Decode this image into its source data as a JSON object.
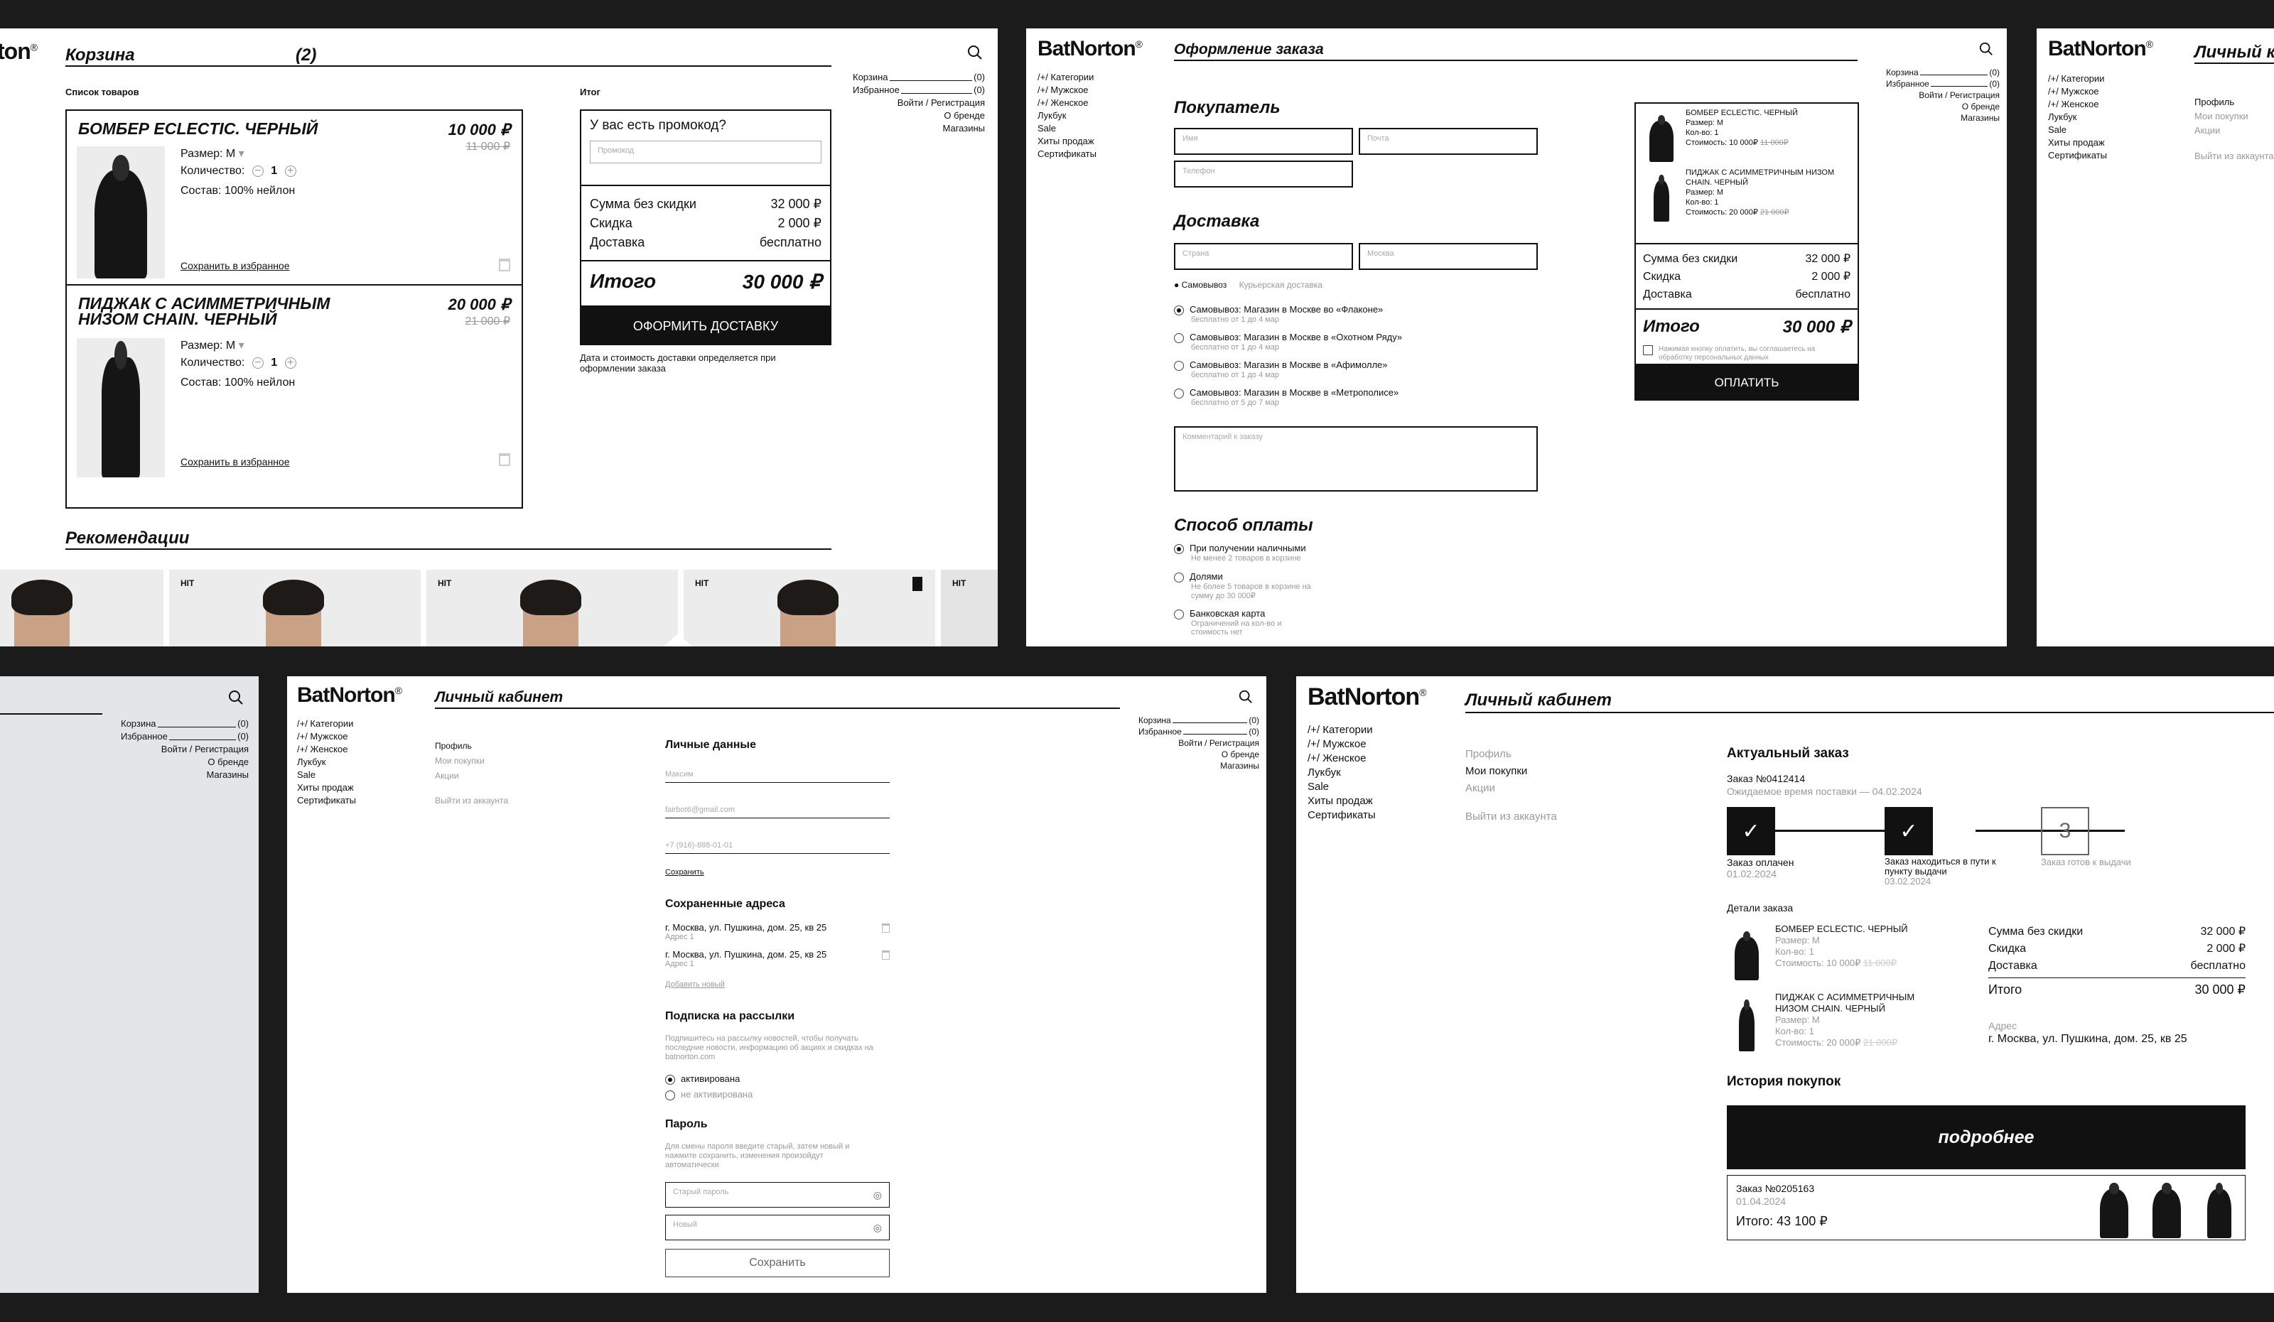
{
  "brand": "BatNorton",
  "reg": "®",
  "topnav": [
    {
      "label": "Корзина",
      "count": "(0)"
    },
    {
      "label": "Избранное",
      "count": "(0)"
    },
    {
      "label": "Войти / Регистрация",
      "count": ""
    },
    {
      "label": "О бренде",
      "count": ""
    },
    {
      "label": "Магазины",
      "count": ""
    }
  ],
  "sidenav": [
    "/+/ Категории",
    "/+/ Мужское",
    "/+/ Женское",
    "Лукбук",
    "Sale",
    "Хиты продаж",
    "Сертификаты"
  ],
  "cart": {
    "title": "Корзина",
    "count": "(2)",
    "brand_fragment": "ton",
    "list_label": "Список товаров",
    "total_label": "Итог",
    "items": [
      {
        "name": "БОМБЕР ECLECTIC. ЧЕРНЫЙ",
        "price": "10 000 ₽",
        "old_price": "11 000 ₽",
        "size_label": "Размер:",
        "size": "M",
        "qty_label": "Количество:",
        "qty": "1",
        "composition": "Состав: 100% нейлон",
        "save": "Сохранить в избранное"
      },
      {
        "name": "ПИДЖАК С АСИММЕТРИЧНЫМ НИЗОМ CHAIN. ЧЕРНЫЙ",
        "price": "20 000 ₽",
        "old_price": "21 000 ₽",
        "size_label": "Размер:",
        "size": "M",
        "qty_label": "Количество:",
        "qty": "1",
        "composition": "Состав: 100% нейлон",
        "save": "Сохранить в избранное"
      }
    ],
    "promo_q": "У вас есть промокод?",
    "promo_ph": "Промокод",
    "sum_label": "Сумма без скидки",
    "sum": "32 000 ₽",
    "disc_label": "Скидка",
    "disc": "2 000 ₽",
    "deliv_label": "Доставка",
    "deliv": "бесплатно",
    "total_big_label": "Итого",
    "total_big": "30 000 ₽",
    "checkout": "ОФОРМИТЬ ДОСТАВКУ",
    "note": "Дата и стоимость доставки определяется при оформлении заказа",
    "reco_title": "Рекомендации",
    "hit": "HIT"
  },
  "checkout": {
    "title": "Оформление заказа",
    "buyer": "Покупатель",
    "name_ph": "Имя",
    "mail_ph": "Почта",
    "phone_ph": "Телефон",
    "delivery": "Доставка",
    "country_ph": "Страна",
    "city_ph": "Москва",
    "tab_pickup": "Самовывоз",
    "tab_courier": "Курьерская доставка",
    "pickups": [
      {
        "title": "Самовывоз: Магазин в Москве во «Флаконе»",
        "sub": "бесплатно от 1 до 4 мар"
      },
      {
        "title": "Самовывоз: Магазин в Москве в «Охотном Ряду»",
        "sub": "бесплатно от 1 до 4 мар"
      },
      {
        "title": "Самовывоз: Магазин в Москве в «Афимолле»",
        "sub": "бесплатно от 1 до 4 мар"
      },
      {
        "title": "Самовывоз: Магазин в Москве в «Метрополисе»",
        "sub": "бесплатно от 5 до 7 мар"
      }
    ],
    "comment_ph": "Комментарий к заказу",
    "pay_title": "Способ оплаты",
    "pays": [
      {
        "title": "При получении наличными",
        "sub": "Не менее 2 товаров в корзине"
      },
      {
        "title": "Долями",
        "sub": "Не более 5 товаров в корзине на сумму до 30 000₽"
      },
      {
        "title": "Банковская карта",
        "sub": "Ограничений на кол-во и стоимость нет"
      }
    ],
    "items": [
      {
        "name": "БОМБЕР ECLECTIC. ЧЕРНЫЙ",
        "size": "Размер: M",
        "qty": "Кол-во: 1",
        "cost": "Стоимость: 10 000₽",
        "old": "11 000₽"
      },
      {
        "name": "ПИДЖАК С АСИММЕТРИЧНЫМ НИЗОМ CHAIN. ЧЕРНЫЙ",
        "size": "Размер: M",
        "qty": "Кол-во: 1",
        "cost": "Стоимость: 20 000₽",
        "old": "21 000₽"
      }
    ],
    "sum_label": "Сумма без скидки",
    "sum": "32 000 ₽",
    "disc_label": "Скидка",
    "disc": "2 000 ₽",
    "deliv_label": "Доставка",
    "deliv": "бесплатно",
    "total_label": "Итого",
    "total": "30 000 ₽",
    "consent": "Нажимая кнопку оплатить, вы соглашаетесь на обработку персональных данных",
    "pay_btn": "ОПЛАТИТЬ"
  },
  "account": {
    "title": "Личный кабинет",
    "title_fragment": "Личный каб",
    "menu": [
      "Профиль",
      "Мои покупки",
      "Акции",
      "Выйти из аккаунта"
    ],
    "personal": "Личные данные",
    "name": "Максим",
    "email": "fairbot6@gmail.com",
    "phone": "+7 (916)-888-01-01",
    "save_link": "Сохранить",
    "addr_title": "Сохраненные адреса",
    "addresses": [
      {
        "text": "г. Москва, ул. Пушкина, дом. 25, кв 25",
        "label": "Адрес 1"
      },
      {
        "text": "г. Москва, ул. Пушкина, дом. 25, кв 25",
        "label": "Адрес 1"
      }
    ],
    "add_new": "Добавить новый",
    "sub_title": "Подписка на рассылки",
    "sub_desc": "Подпишитесь на рассылку новостей, чтобы получать последние новости, информацию об акциях и скидках на batnorton.com",
    "sub_on": "активирована",
    "sub_off": "не активирована",
    "pass_title": "Пароль",
    "pass_desc": "Для смены пароля введите старый, затем новый и нажмите сохранить, изменения произойдут автоматически",
    "old_pass": "Старый пароль",
    "new_pass": "Новый",
    "save_btn": "Сохранить"
  },
  "orders": {
    "title": "Личный кабинет",
    "current": "Актуальный заказ",
    "order_no": "Заказ №0412414",
    "eta": "Ожидаемое время поставки — 04.02.2024",
    "steps": [
      {
        "label": "Заказ оплачен",
        "date": "01.02.2024",
        "mark": "✓"
      },
      {
        "label": "Заказ находиться в пути к пункту выдачи",
        "date": "03.02.2024",
        "mark": "✓"
      },
      {
        "label": "Заказ готов к выдачи",
        "date": "",
        "mark": "3"
      }
    ],
    "details": "Детали заказа",
    "items": [
      {
        "name": "БОМБЕР ECLECTIC. ЧЕРНЫЙ",
        "size": "Размер: M",
        "qty": "Кол-во: 1",
        "cost": "Стоимость: 10 000₽",
        "old": "11 000₽"
      },
      {
        "name": "ПИДЖАК С АСИММЕТРИЧНЫМ НИЗОМ CHAIN. ЧЕРНЫЙ",
        "size": "Размер: M",
        "qty": "Кол-во: 1",
        "cost": "Стоимость: 20 000₽",
        "old": "21 000₽"
      }
    ],
    "sum_label": "Сумма без скидки",
    "sum": "32 000 ₽",
    "disc_label": "Скидка",
    "disc": "2 000 ₽",
    "deliv_label": "Доставка",
    "deliv": "бесплатно",
    "total_label": "Итого",
    "total": "30 000 ₽",
    "addr_label": "Адрес",
    "addr": "г. Москва, ул. Пушкина, дом. 25, кв 25",
    "history": "История покупок",
    "more": "подробнее",
    "past_no": "Заказ №0205163",
    "past_date": "01.04.2024",
    "past_total": "Итого: 43 100 ₽"
  }
}
